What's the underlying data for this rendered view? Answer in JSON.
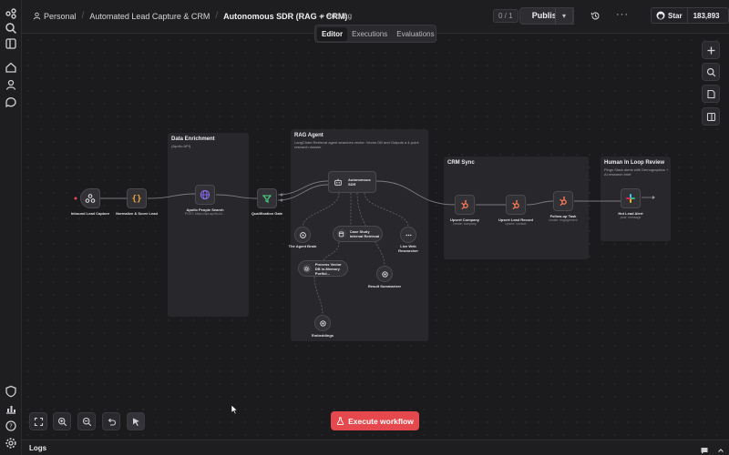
{
  "header": {
    "breadcrumbs": [
      "Personal",
      "Automated Lead Capture & CRM",
      "Autonomous SDR (RAG + CRM)"
    ],
    "add_tag": "+ Add tag",
    "counter": "0 / 1",
    "publish": "Publish",
    "star": "Star",
    "star_count": "183,893"
  },
  "tabs": [
    {
      "label": "Editor",
      "active": true
    },
    {
      "label": "Executions",
      "active": false
    },
    {
      "label": "Evaluations",
      "active": false
    }
  ],
  "stickies": {
    "enrichment": {
      "title": "Data Enrichment",
      "sub": "(Apollo API)"
    },
    "rag": {
      "title": "RAG Agent",
      "sub": "LangChain Retrieval agent searches vector: Vector DB and Outputs a 4-point research dossier"
    },
    "crm": {
      "title": "CRM Sync",
      "sub": ""
    },
    "human": {
      "title": "Human In Loop Review",
      "sub": "Pings Slack alerts with Demographics + AI research brief"
    }
  },
  "nodes": {
    "inbound": {
      "label": "Inbound Lead Capture"
    },
    "normalize": {
      "label": "Normalize & Score Lead"
    },
    "apollo": {
      "label": "Apollo People Search",
      "sub": "POST: https://api.apollo.io/..."
    },
    "qualify": {
      "label": "Qualification Gate"
    },
    "sdr": {
      "label": "Autonomous SDR"
    },
    "brain": {
      "label": "The Agent Brain"
    },
    "casestudy": {
      "label": "Case Study Internal Retrieval"
    },
    "websearch": {
      "label": "Live Web Researcher"
    },
    "vector": {
      "label": "Process Vector DB In-Memory Portfol..."
    },
    "summarizer": {
      "label": "Result Summarizer"
    },
    "embeddings": {
      "label": "Embeddings"
    },
    "upsert_company": {
      "label": "Upsert Company",
      "sub": "create: company"
    },
    "upsert_lead": {
      "label": "Upsert Lead Record",
      "sub": "upsert: contact"
    },
    "followup": {
      "label": "Follow-up Task",
      "sub": "create: engagement"
    },
    "hot_alert": {
      "label": "Hot Lead Alert",
      "sub": "post: message"
    }
  },
  "execute_button": "Execute workflow",
  "logs": {
    "label": "Logs"
  },
  "colors": {
    "accent_red": "#e5484d",
    "hubspot": "#ff7a59",
    "apollo": "#8b6cf6",
    "filter": "#4ad88a"
  },
  "icons": {
    "rail": [
      "search-icon",
      "panel-icon",
      "home-icon",
      "user-icon",
      "chat-icon",
      "shield-icon",
      "chart-icon",
      "help-icon",
      "settings-icon"
    ],
    "right_tools": [
      "plus-icon",
      "search-icon",
      "note-icon",
      "panel-icon"
    ],
    "bottom_tools": [
      "fit-view-icon",
      "zoom-in-icon",
      "zoom-out-icon",
      "undo-icon",
      "cursor-icon"
    ]
  }
}
